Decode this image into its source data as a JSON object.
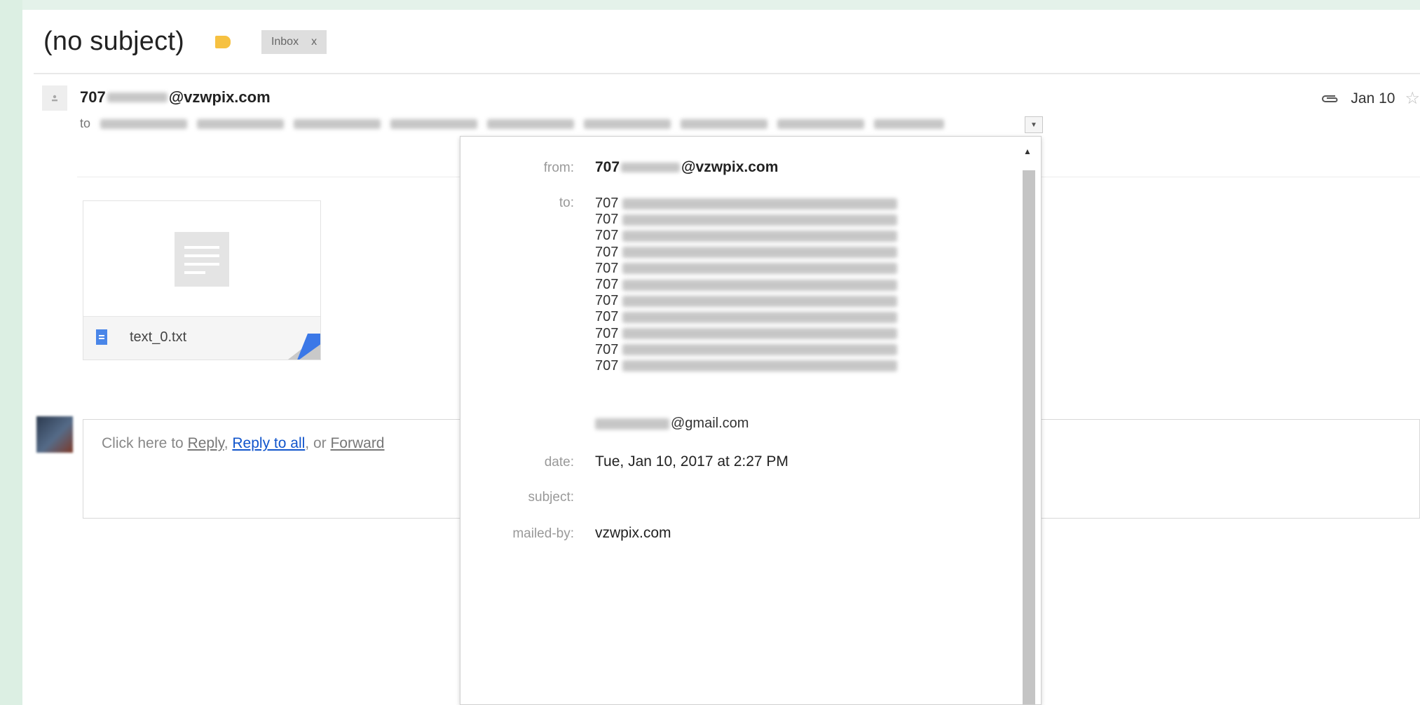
{
  "header": {
    "subject": "(no subject)",
    "label_color": "#f6c141",
    "inbox_chip": {
      "label": "Inbox",
      "close": "x"
    }
  },
  "message": {
    "sender_prefix": "707",
    "sender_domain": "@vzwpix.com",
    "to_label": "to",
    "date": "Jan 10",
    "attachment": {
      "filename": "text_0.txt"
    }
  },
  "reply": {
    "prefix": "Click here to",
    "reply": "Reply",
    "sep1": ",",
    "reply_all": "Reply to all",
    "sep2": ", or",
    "forward": "Forward"
  },
  "details": {
    "from_label": "from:",
    "from_prefix": "707",
    "from_domain": "@vzwpix.com",
    "to_label": "to:",
    "to_prefixes": [
      "707",
      "707",
      "707",
      "707",
      "707",
      "707",
      "707",
      "707",
      "707",
      "707",
      "707"
    ],
    "gmail_suffix": "@gmail.com",
    "date_label": "date:",
    "date_value": "Tue, Jan 10, 2017 at 2:27 PM",
    "subject_label": "subject:",
    "mailed_by_label": "mailed-by:",
    "mailed_by_value": "vzwpix.com"
  },
  "colors": {
    "link": "#1155cc",
    "attachment_icon": "#4a86e8",
    "accent_green": "#dcefe3"
  }
}
